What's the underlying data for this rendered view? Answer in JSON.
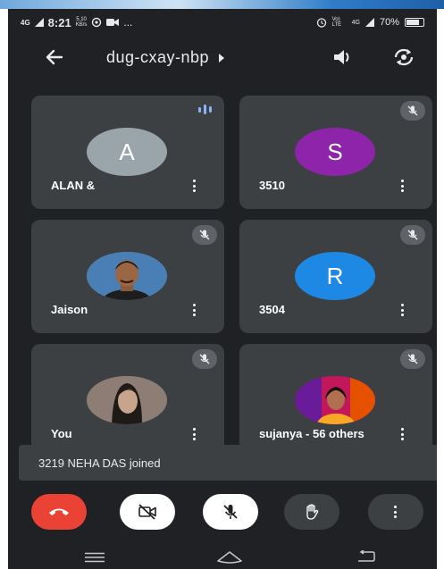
{
  "status_bar": {
    "network": "4G",
    "time": "8:21",
    "speed_value": "5.10",
    "speed_unit": "KB/s",
    "more": "...",
    "volte": "Vo) LTE",
    "signal": "4G",
    "battery": "70%",
    "battery_level": 0.7
  },
  "header": {
    "meeting_code": "dug-cxay-nbp"
  },
  "participants": [
    {
      "name": "ALAN &",
      "initial": "A",
      "avatar_color": "#9aa5ab",
      "audio": "speaking",
      "photo": false
    },
    {
      "name": "3510",
      "initial": "S",
      "avatar_color": "#8e24aa",
      "audio": "muted",
      "photo": false
    },
    {
      "name": "Jaison",
      "initial": "",
      "avatar_color": "#4a7fb5",
      "audio": "muted",
      "photo": true
    },
    {
      "name": "3504",
      "initial": "R",
      "avatar_color": "#1e88e5",
      "audio": "muted",
      "photo": false
    },
    {
      "name": "You",
      "initial": "",
      "avatar_color": "#8d7d74",
      "audio": "muted",
      "photo": true
    },
    {
      "name": "sujanya - 56 others",
      "initial": "",
      "avatar_color": "#c2185b",
      "audio": "muted",
      "photo": true
    }
  ],
  "toast": {
    "message": "3219 NEHA DAS joined"
  },
  "controls": {
    "end_call_color": "#ea4335",
    "camera_state": "off",
    "mic_state": "off"
  },
  "colors": {
    "background": "#202124",
    "tile": "#3c4043",
    "accent": "#8ab4f8"
  }
}
